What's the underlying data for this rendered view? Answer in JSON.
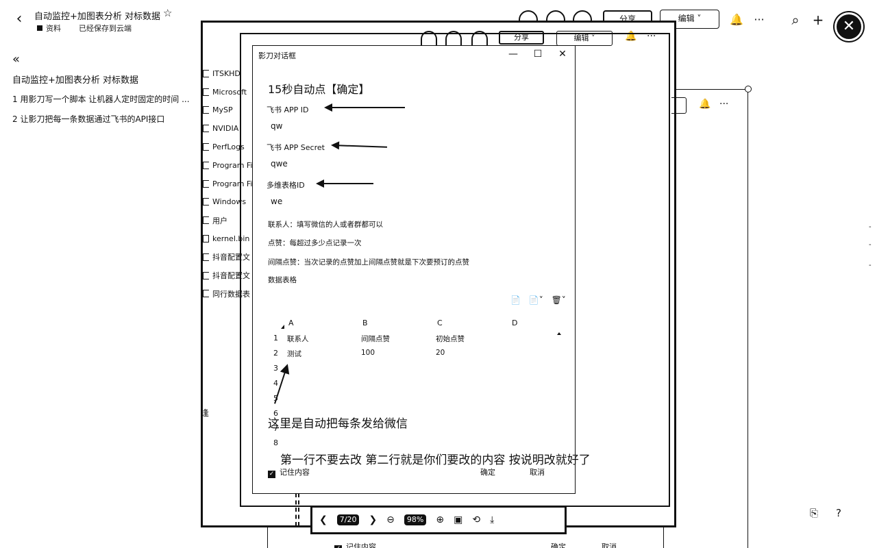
{
  "header": {
    "back_icon": "‹",
    "title": "自动监控+加图表分析 对标数据",
    "star_icon": "☆",
    "folder": "资料",
    "save_status": "已经保存到云端",
    "share_label": "分享",
    "edit_label": "编辑 ˅",
    "bell_icon": "🔔",
    "more_icon": "···",
    "search_icon": "⌕",
    "add_icon": "+",
    "close_icon": "✕"
  },
  "outline": {
    "collapse_icon": "«",
    "title": "自动监控+加图表分析 对标数据",
    "items": [
      "1 用影刀写一个脚本 让机器人定时固定的时间 ...",
      "2 让影刀把每一条数据通过飞书的API接口"
    ]
  },
  "inner_header": {
    "share_label": "分享",
    "edit_label": "编辑 ˅",
    "bell_icon": "🔔",
    "more_icon": "···"
  },
  "file_tree": [
    "ITSKHD",
    "Microsoft",
    "MySP",
    "NVIDIA",
    "PerfLogs",
    "Program Fi",
    "Program Fi",
    "Windows",
    "用户",
    "kernel.bin",
    "抖音配置文",
    "抖音配置文",
    "同行数据表"
  ],
  "dialog": {
    "title": "影刀对话框",
    "min_icon": "—",
    "max_icon": "☐",
    "close_icon": "✕",
    "heading": "15秒自动点【确定】",
    "fields": [
      {
        "label": "飞书 APP ID",
        "value": "qw"
      },
      {
        "label": "飞书 APP Secret",
        "value": "qwe"
      },
      {
        "label": "多维表格ID",
        "value": "we"
      }
    ],
    "notes": [
      "联系人：填写微信的人或者群都可以",
      "点赞：每超过多少点记录一次",
      "间隔点赞：当次记录的点赞加上间隔点赞就是下次要预订的点赞",
      "数据表格"
    ],
    "sheet_tools": [
      "📄",
      "📄˅",
      "🗑˅"
    ],
    "columns": [
      "A",
      "B",
      "C",
      "D"
    ],
    "row_numbers": [
      "1",
      "2",
      "3",
      "4",
      "5",
      "6",
      "7",
      "8"
    ],
    "rows": [
      [
        "联系人",
        "间隔点赞",
        "初始点赞"
      ],
      [
        "测试",
        "100",
        "20"
      ]
    ],
    "annotation_1": "这里是自动把每条发给微信",
    "annotation_2": "第一行不要去改 第二行就是你们要改的内容 按说明改就好了",
    "remember_label": "记住内容",
    "confirm_label": "确定",
    "cancel_label": "取消"
  },
  "viewer": {
    "prev_icon": "❮",
    "page": "7/20",
    "next_icon": "❯",
    "zoom_out_icon": "⊖",
    "zoom": "98%",
    "zoom_in_icon": "⊕",
    "fit_icon": "▣",
    "rotate_icon": "⟲",
    "download_icon": "⤓"
  },
  "bottom": {
    "remember_label": "记住内容",
    "confirm_label": "确定",
    "cancel_label": "取消",
    "side_char": "逢",
    "corner_icons": [
      "⎘",
      "?"
    ]
  }
}
